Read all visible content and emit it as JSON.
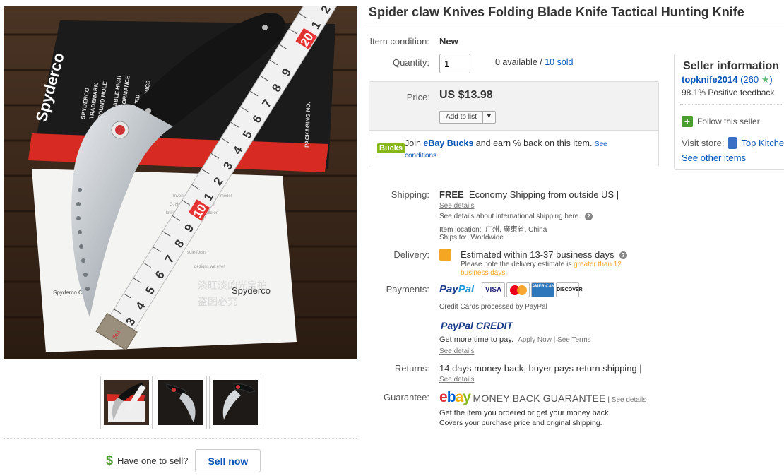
{
  "title": "Spider claw Knives Folding Blade Knife Tactical Hunting Knife",
  "condition": {
    "label": "Item condition:",
    "value": "New"
  },
  "quantity": {
    "label": "Quantity:",
    "value": "1",
    "available": "0 available",
    "sep": " / ",
    "sold": "10 sold"
  },
  "price": {
    "label": "Price:",
    "value": "US $13.98",
    "add_to_list": "Add to list",
    "caret": "▼"
  },
  "bucks": {
    "badge": "Bucks",
    "text_pre": "Join ",
    "brand": "eBay Bucks",
    "text_post": " and earn % back on this item. ",
    "see": "See",
    "conditions": "conditions"
  },
  "seller": {
    "title": "Seller information",
    "name": "topknife2014",
    "score_open": " (260 ",
    "star": "★",
    "score_close": ")",
    "feedback": "98.1% Positive feedback",
    "follow": "Follow this seller",
    "visit_label": "Visit store:",
    "store_name": "Top Kitchen Knife",
    "see_other": "See other items"
  },
  "shipping": {
    "label": "Shipping:",
    "free": "FREE",
    "method": "Economy Shipping from outside US |",
    "see_details": "See details",
    "intl": "See details about international shipping here.",
    "location_label": "Item location:",
    "location": "广州, 廣東省, China",
    "ships_label": "Ships to:",
    "ships_to": "Worldwide"
  },
  "delivery": {
    "label": "Delivery:",
    "estimate": "Estimated within 13-37 business days",
    "note_pre": "Please note the delivery estimate is ",
    "note_hi": "greater than 12 business days."
  },
  "payments": {
    "label": "Payments:",
    "paypal_a": "Pay",
    "paypal_b": "Pal",
    "cards": [
      "VISA",
      "MasterCard",
      "AMERICAN EXPRESS",
      "DISCOVER"
    ],
    "processed": "Credit Cards processed by PayPal",
    "credit_a": "PayPal",
    "credit_b": " CREDIT",
    "more_time": "Get more time to pay.",
    "apply": "Apply Now",
    "bar": " | ",
    "terms": "See Terms",
    "see_details": "See details"
  },
  "returns": {
    "label": "Returns:",
    "text": "14 days money back, buyer pays return shipping |",
    "see_details": "See details"
  },
  "guarantee": {
    "label": "Guarantee:",
    "e1": "e",
    "e2": "b",
    "e3": "a",
    "e4": "y",
    "mbg": "MONEY BACK GUARANTEE",
    "bar": " | ",
    "see_details": "See details",
    "line1": "Get the item you ordered or get your money back.",
    "line2": "Covers your purchase price and original shipping."
  },
  "sell": {
    "dollar": "$",
    "question": "Have one to sell?",
    "button": "Sell now"
  },
  "image": {
    "box_brand": "Spyderco",
    "box_line1": "SPYDERCO",
    "box_line2": "TRADEMARK",
    "box_line3": "ROUND HOLE",
    "box_line4": "RELIABLE HIGH",
    "box_line5": "PERFORMANCE",
    "box_line6": "REFINED",
    "box_line7": "ERGONOMICS",
    "box_line8": "PACKAGING NO.",
    "paper_brand": "Spyderco",
    "watermark1": "淡旺淡的光宝拍",
    "watermark2": "盗图必究",
    "sign": "Spyderco Crew",
    "ruler_numbers": [
      "3",
      "4",
      "5",
      "6",
      "7",
      "8",
      "9",
      "10",
      "1",
      "2",
      "3",
      "4",
      "5",
      "6",
      "7",
      "8",
      "9",
      "20",
      "1",
      "2"
    ],
    "tape_label": "5m"
  }
}
